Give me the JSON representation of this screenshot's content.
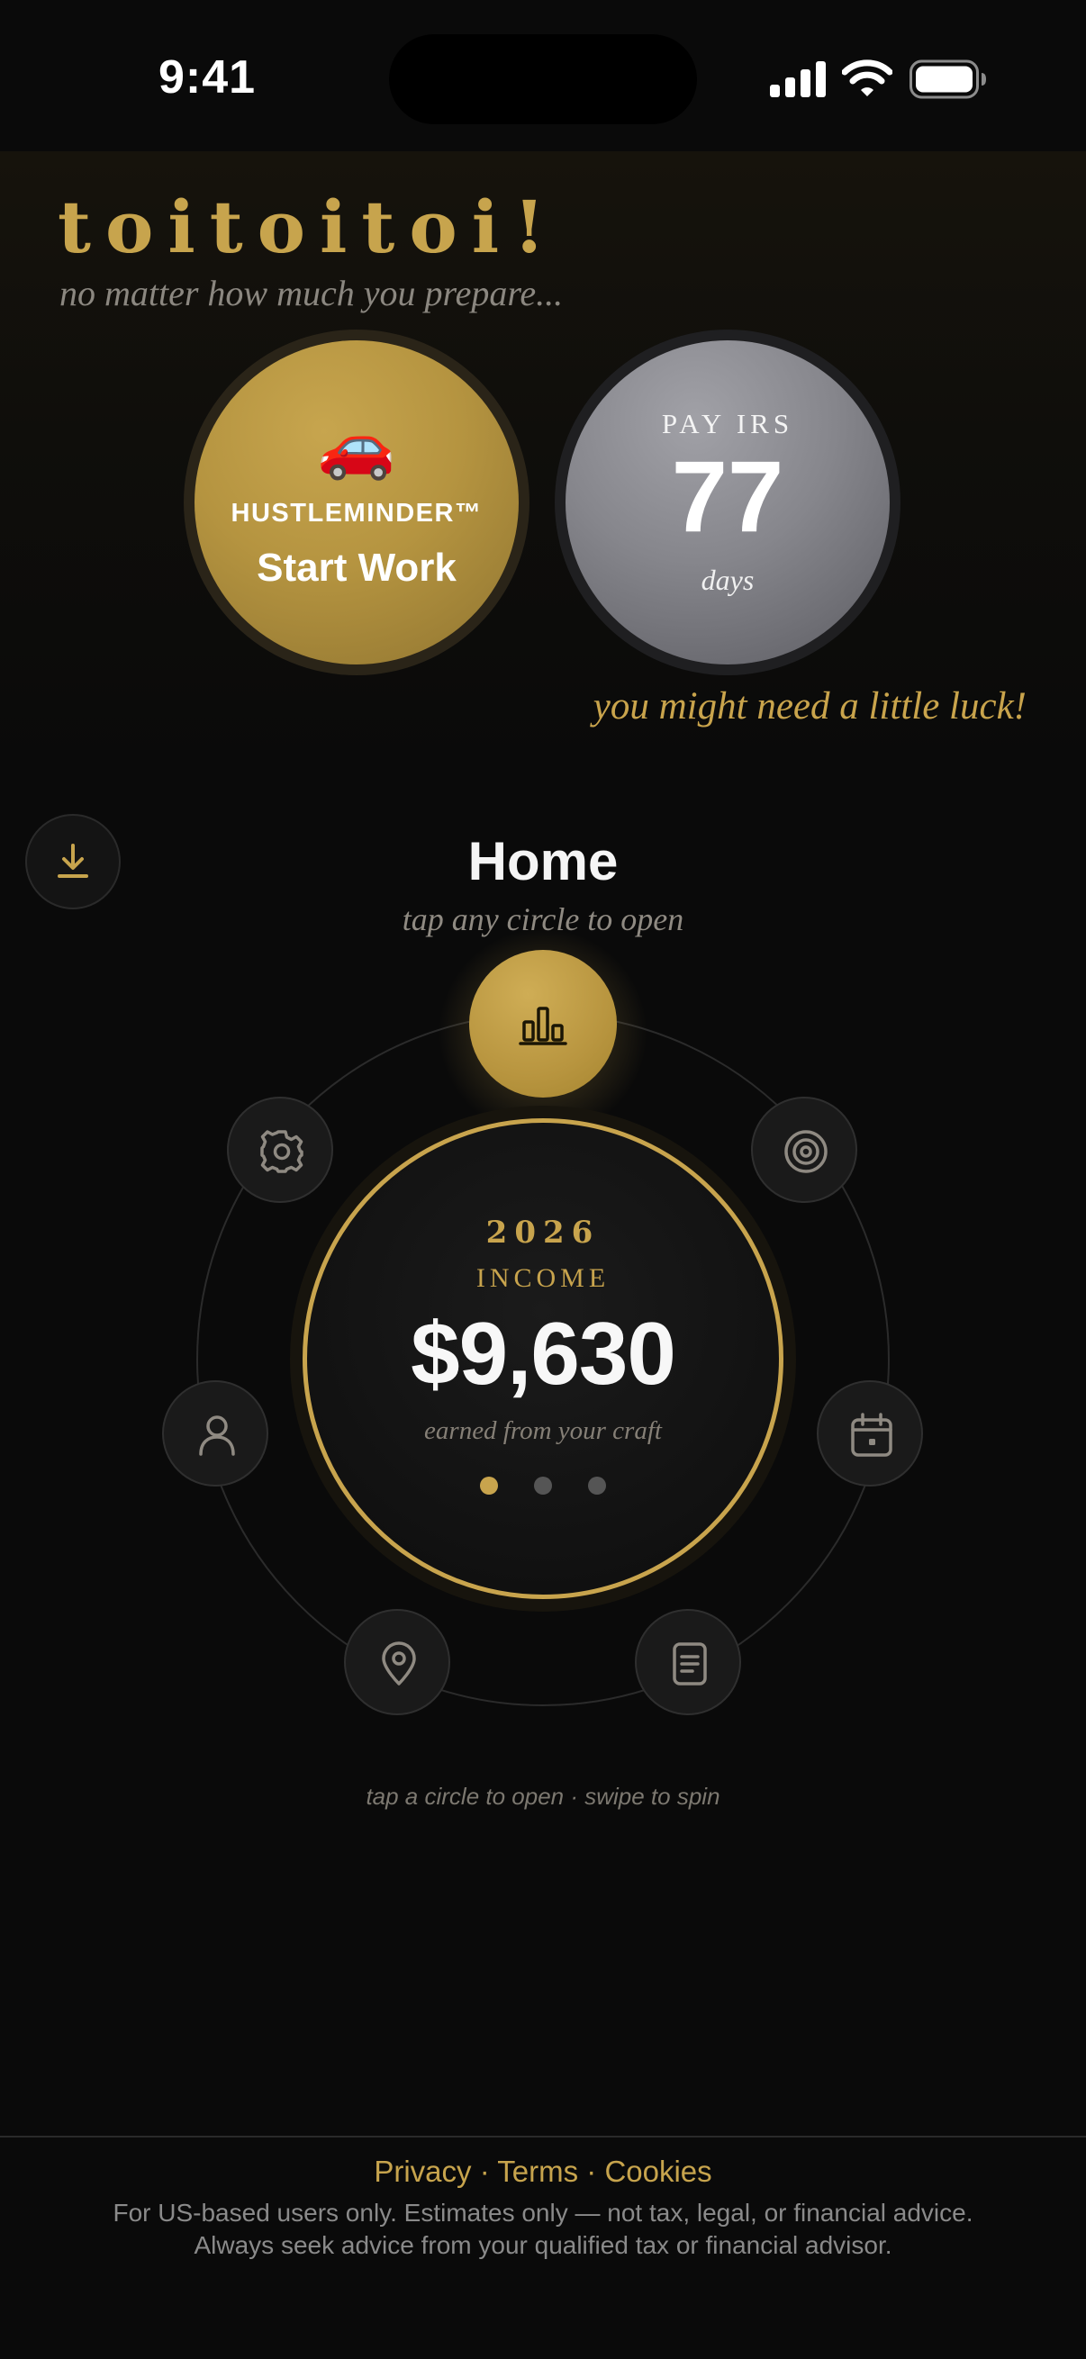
{
  "status_bar": {
    "time": "9:41",
    "icons": [
      "cellular-signal-icon",
      "wifi-icon",
      "battery-icon"
    ]
  },
  "header": {
    "brand": "toitoitoi!",
    "tagline": "no matter how much you prepare...",
    "luck_text": "you might need a little luck!"
  },
  "hustle_circle": {
    "emoji": "🚗",
    "label": "HUSTLEMINDER™",
    "action": "Start Work"
  },
  "irs_circle": {
    "label": "PAY IRS",
    "days_value": "77",
    "days_unit": "days"
  },
  "home": {
    "title": "Home",
    "subtitle": "tap any circle to open",
    "hint": "tap a circle to open · swipe to spin",
    "download_icon": "download-icon",
    "orbit_items": [
      {
        "icon": "bar-chart-icon",
        "active": true
      },
      {
        "icon": "target-icon",
        "active": false
      },
      {
        "icon": "calendar-icon",
        "active": false
      },
      {
        "icon": "document-icon",
        "active": false
      },
      {
        "icon": "location-pin-icon",
        "active": false
      },
      {
        "icon": "person-icon",
        "active": false
      },
      {
        "icon": "gear-icon",
        "active": false
      }
    ],
    "center": {
      "year": "2026",
      "label": "INCOME",
      "value": "$9,630",
      "note": "earned from your craft",
      "page_count": 3,
      "active_page": 1
    }
  },
  "footer": {
    "links": [
      "Privacy",
      "Terms",
      "Cookies"
    ],
    "separator": "·",
    "disclaimer_line1": "For US-based users only. Estimates only — not tax, legal, or financial advice.",
    "disclaimer_line2": "Always seek advice from your qualified tax or financial advisor."
  },
  "colors": {
    "background": "#0a0a0a",
    "gold": "#c7a44d",
    "silver": "#86868c",
    "muted_text": "#8a8a8a"
  }
}
